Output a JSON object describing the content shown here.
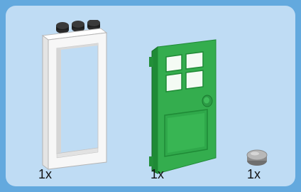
{
  "parts": [
    {
      "id": "frame",
      "name": "window-frame",
      "quantity": "1x"
    },
    {
      "id": "door",
      "name": "green-door",
      "quantity": "1x"
    },
    {
      "id": "stud",
      "name": "round-tile",
      "quantity": "1x"
    }
  ],
  "colors": {
    "border": "#63a9de",
    "panel": "#bfdcf4",
    "frame_white": "#f5f5f5",
    "door_green": "#2fa84a",
    "stud_gray": "#9a9a9a"
  }
}
